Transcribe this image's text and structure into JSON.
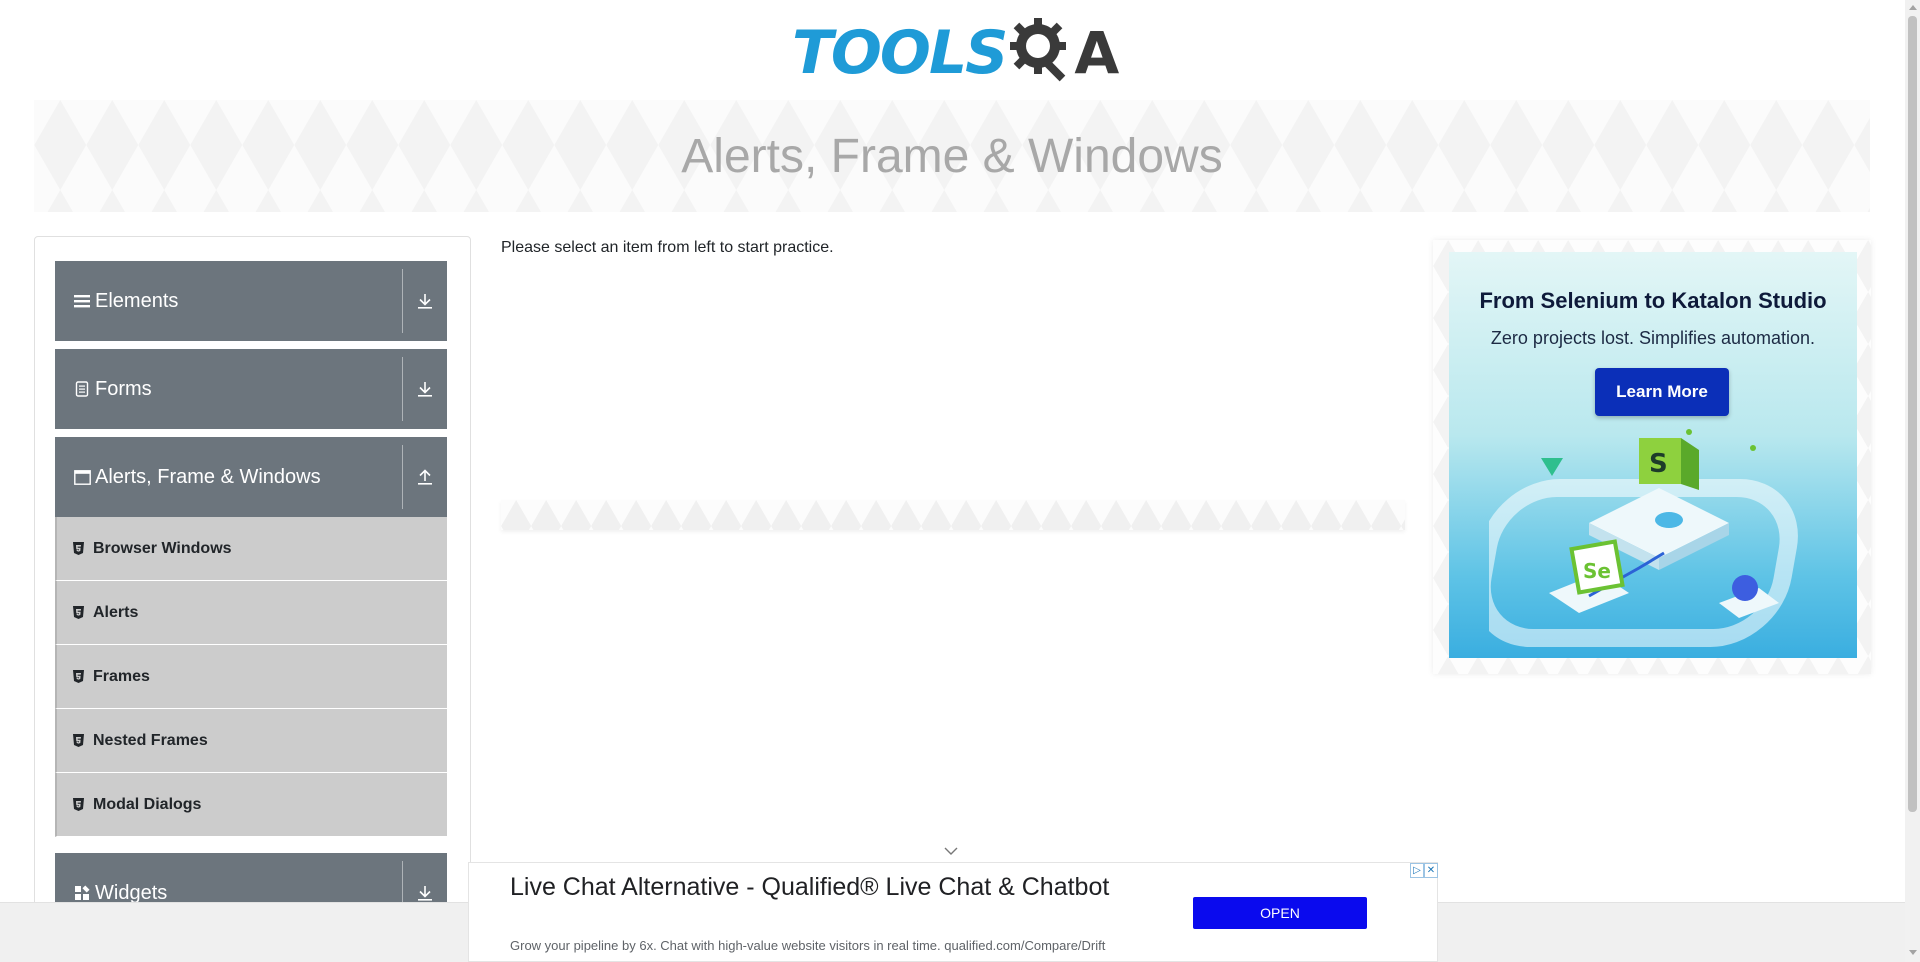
{
  "logo": {
    "text": "TOOLS",
    "tail": "A"
  },
  "banner": {
    "title": "Alerts, Frame & Windows"
  },
  "sidebar": {
    "groups": [
      {
        "label": "Elements",
        "icon": "menu-icon",
        "arrow": "download-icon"
      },
      {
        "label": "Forms",
        "icon": "document-icon",
        "arrow": "download-icon"
      },
      {
        "label": "Alerts, Frame & Windows",
        "icon": "window-icon",
        "arrow": "upload-icon"
      },
      {
        "label": "Widgets",
        "icon": "grid-icon",
        "arrow": "download-icon"
      }
    ],
    "items": [
      {
        "label": "Browser Windows",
        "icon": "html5-icon"
      },
      {
        "label": "Alerts",
        "icon": "html5-icon"
      },
      {
        "label": "Frames",
        "icon": "html5-icon"
      },
      {
        "label": "Nested Frames",
        "icon": "html5-icon"
      },
      {
        "label": "Modal Dialogs",
        "icon": "html5-icon"
      }
    ]
  },
  "main": {
    "instruction": "Please select an item from left to start practice."
  },
  "side_ad": {
    "title": "From Selenium to Katalon Studio",
    "subtitle": "Zero projects lost. Simplifies automation.",
    "button": "Learn More",
    "colors": {
      "button": "#0b2fb8",
      "bg_top": "#e3f6f6",
      "bg_bottom": "#3aaee0"
    }
  },
  "bottom_ad": {
    "headline": "Live Chat Alternative - Qualified® Live Chat & Chatbot",
    "description": "Grow your pipeline by 6x. Chat with high-value website visitors in real time. qualified.com/Compare/Drift",
    "button": "OPEN",
    "button_color": "#0a0aee"
  },
  "colors": {
    "brand_blue": "#1f9bd7",
    "group_header": "#6c757d",
    "sub_item": "#cccccc",
    "banner_text": "#a8a8a8"
  }
}
